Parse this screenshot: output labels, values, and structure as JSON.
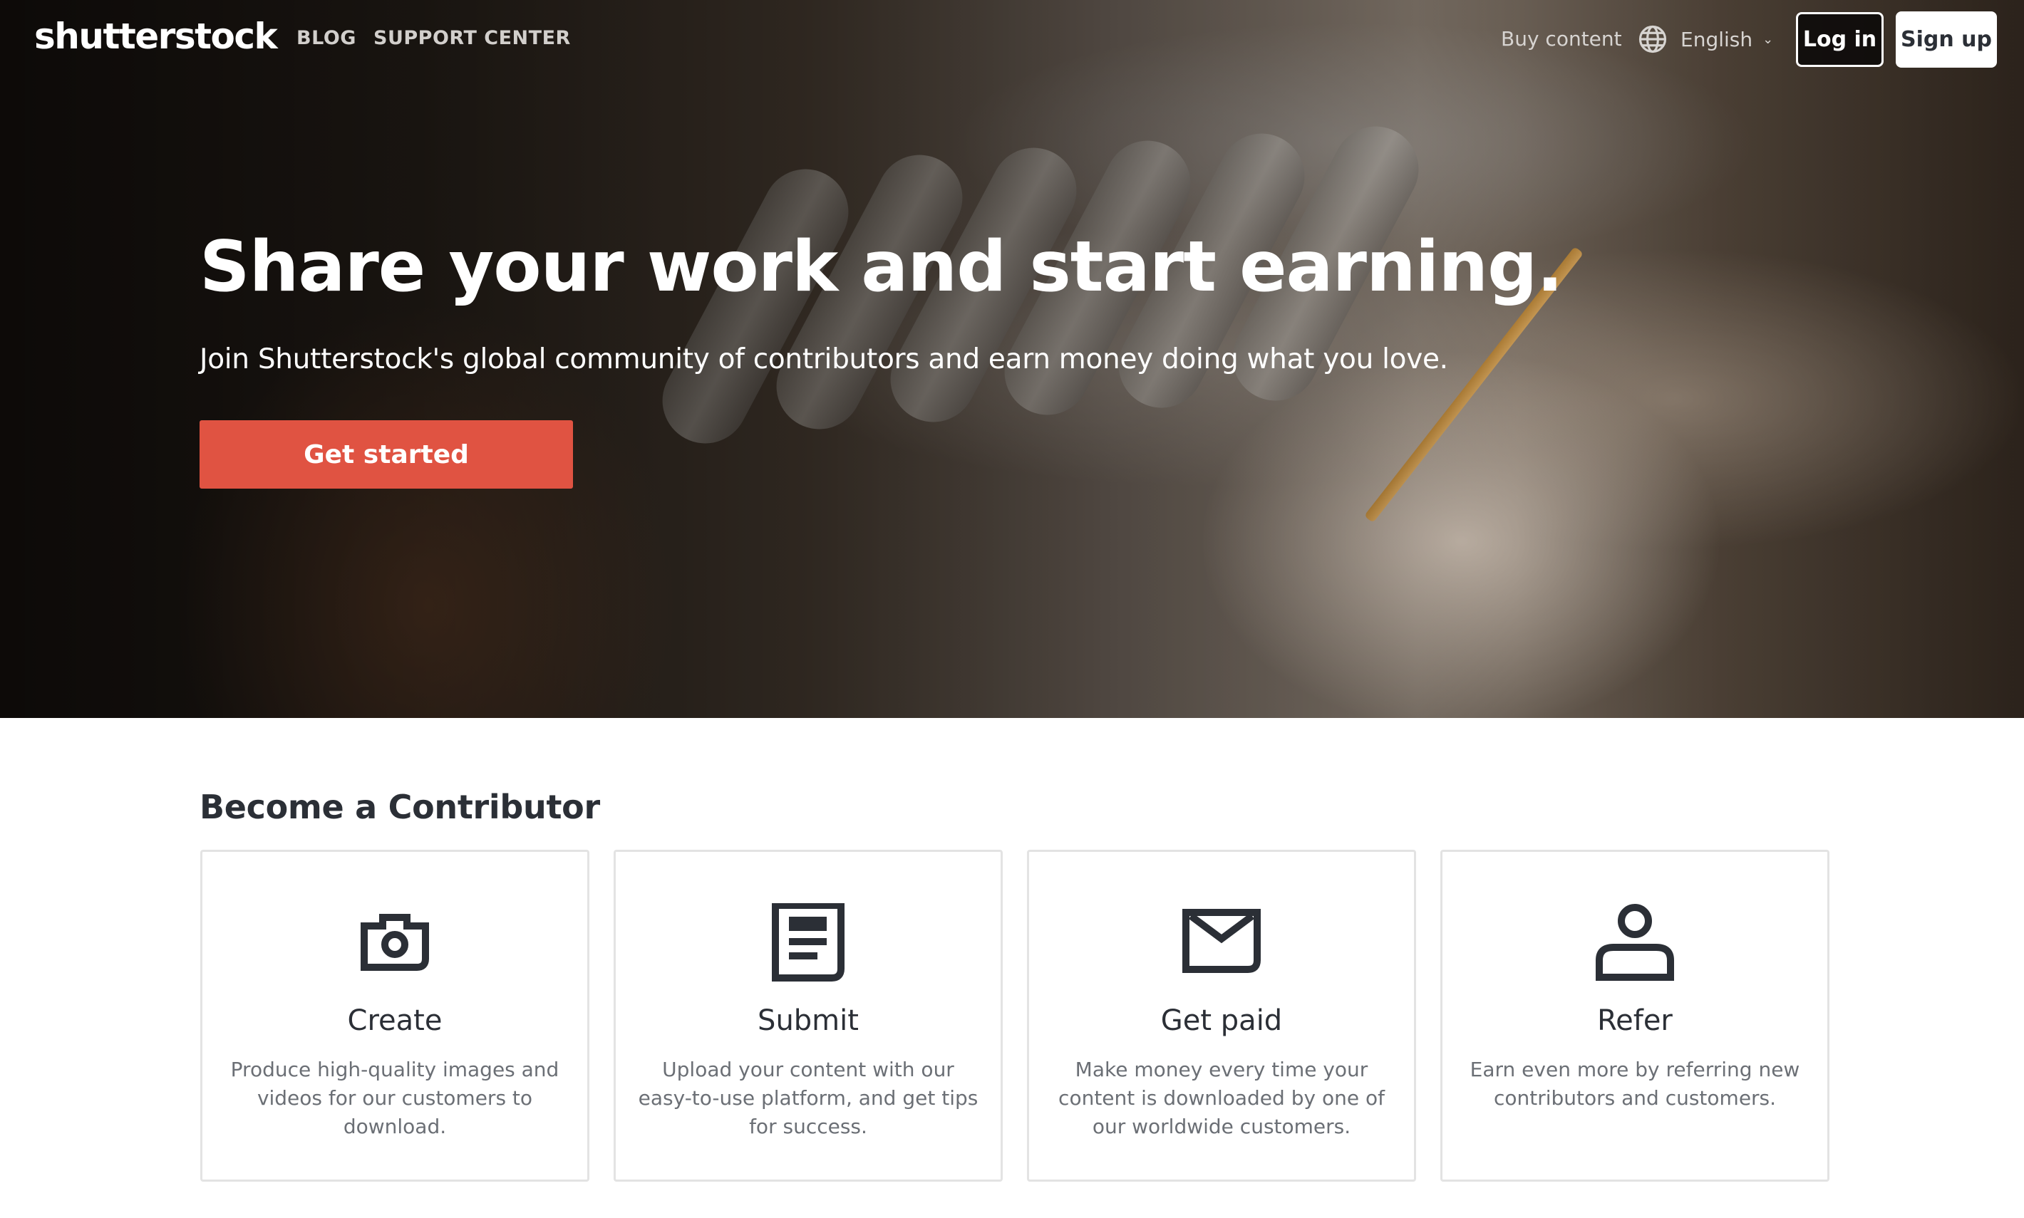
{
  "nav": {
    "logo": "shutterstock",
    "links": [
      {
        "label": "BLOG"
      },
      {
        "label": "SUPPORT CENTER"
      }
    ],
    "buy_content": "Buy content",
    "language": {
      "icon": "globe-icon",
      "selected": "English",
      "chevron": "chevron-down-icon"
    },
    "login_label": "Log in",
    "signup_label": "Sign up"
  },
  "hero": {
    "title": "Share your work and start earning.",
    "subtitle": "Join Shutterstock's global community of contributors and earn money doing what you love.",
    "cta_label": "Get started",
    "cta_color": "#e05342"
  },
  "contributor": {
    "title": "Become a Contributor",
    "cards": [
      {
        "icon": "camera-icon",
        "title": "Create",
        "description": "Produce high-quality images and videos for our customers to download."
      },
      {
        "icon": "document-icon",
        "title": "Submit",
        "description": "Upload your content with our easy-to-use platform, and get tips for success."
      },
      {
        "icon": "envelope-icon",
        "title": "Get paid",
        "description": "Make money every time your content is downloaded by one of our worldwide customers."
      },
      {
        "icon": "person-icon",
        "title": "Refer",
        "description": "Earn even more by referring new contributors and customers."
      }
    ]
  },
  "colors": {
    "text_dark": "#2b2f36",
    "text_muted": "#6b6f75",
    "card_border": "#e3e3e3",
    "accent": "#e05342"
  }
}
